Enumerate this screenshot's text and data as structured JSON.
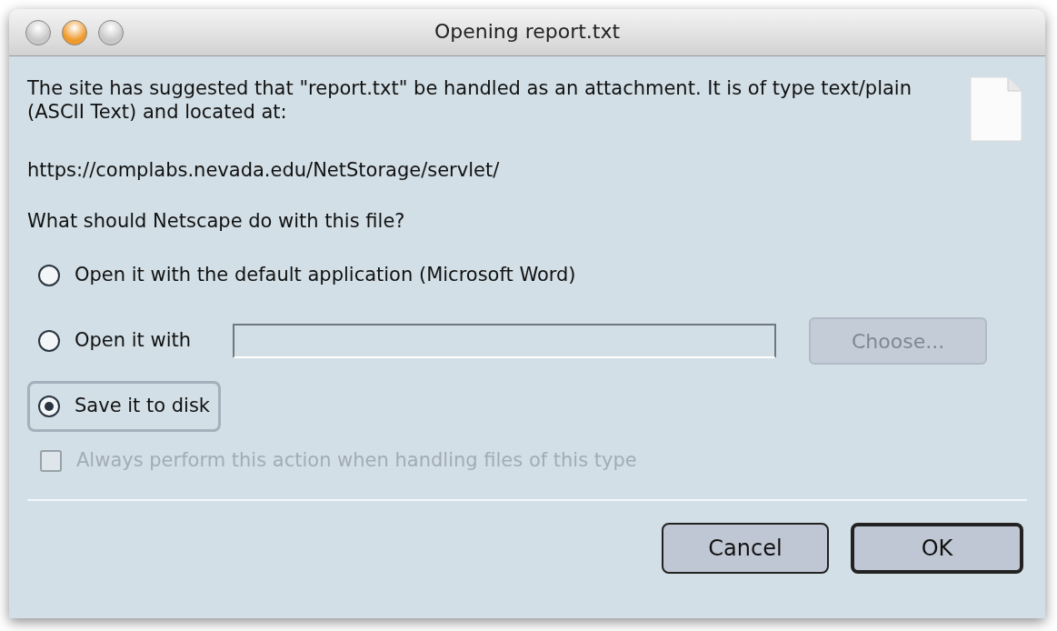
{
  "window": {
    "title": "Opening report.txt",
    "traffic_lights": [
      {
        "color": "#c8c8c8"
      },
      {
        "color": "#ee9a2c"
      },
      {
        "color": "#c8c8c8"
      }
    ]
  },
  "message": "The site has suggested that \"report.txt\" be handled as an attachment. It is of type text/plain (ASCII Text) and located at:",
  "location": "https://complabs.nevada.edu/NetStorage/servlet/",
  "question": "What should Netscape do with this file?",
  "options": [
    {
      "label": "Open it with the default application (Microsoft Word)",
      "selected": false
    },
    {
      "label": "Open it with",
      "selected": false,
      "field": true,
      "button": {
        "label": "Choose...",
        "disabled": true
      }
    },
    {
      "label": "Save it to disk",
      "selected": true
    }
  ],
  "always": {
    "label": "Always perform this action when handling files of this type",
    "checked": false,
    "disabled": true
  },
  "buttons": [
    {
      "label": "Cancel",
      "default": false
    },
    {
      "label": "OK",
      "default": true
    }
  ]
}
